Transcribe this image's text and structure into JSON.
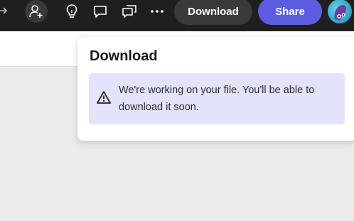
{
  "toolbar": {
    "download_label": "Download",
    "share_label": "Share"
  },
  "download_popover": {
    "title": "Download",
    "message": "We're working on your file. You'll be able to download it soon."
  },
  "colors": {
    "topbar": "#1f1f1f",
    "share_button": "#5c5ce0",
    "download_button": "#3a3a3a",
    "info_box": "#e3e3fb"
  },
  "icons": [
    "arrow-icon",
    "add-user-icon",
    "lightbulb-icon",
    "comment-icon",
    "chats-icon",
    "more-icon",
    "warning-icon"
  ]
}
